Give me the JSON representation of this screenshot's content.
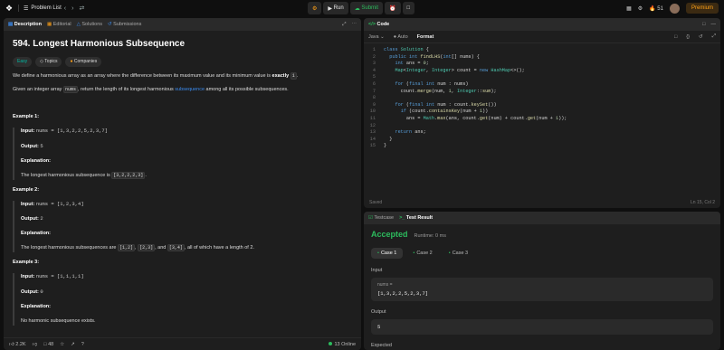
{
  "topbar": {
    "problem_list": "Problem List",
    "run": "Run",
    "submit": "Submit",
    "streak": "51",
    "premium": "Premium"
  },
  "left": {
    "tabs": [
      "Description",
      "Editorial",
      "Solutions",
      "Submissions"
    ],
    "title": "594. Longest Harmonious Subsequence",
    "tags": [
      "Easy",
      "Topics",
      "Companies"
    ],
    "p1_a": "We define a harmonious array as an array where the difference between its maximum value and its minimum value is ",
    "p1_b": "exactly",
    "p1_c": "1",
    "p1_d": ".",
    "p2_a": "Given an integer array ",
    "p2_b": "nums",
    "p2_c": ", return the length of its longest harmonious ",
    "p2_d": "subsequence",
    "p2_e": " among all its possible subsequences.",
    "examples": [
      {
        "head": "Example 1:",
        "input_label": "Input:",
        "input": "nums = [1,3,2,2,5,2,3,7]",
        "output_label": "Output:",
        "output": "5",
        "expl_label": "Explanation:",
        "expl_a": "The longest harmonious subsequence is ",
        "expl_b": "[3,2,2,2,3]",
        "expl_c": "."
      },
      {
        "head": "Example 2:",
        "input_label": "Input:",
        "input": "nums = [1,2,3,4]",
        "output_label": "Output:",
        "output": "2",
        "expl_label": "Explanation:",
        "expl_a": "The longest harmonious subsequences are ",
        "expl_b": "[1,2]",
        "expl_c": ", ",
        "expl_d": "[2,3]",
        "expl_e": ", and ",
        "expl_f": "[3,4]",
        "expl_g": ", all of which have a length of 2."
      },
      {
        "head": "Example 3:",
        "input_label": "Input:",
        "input": "nums = [1,1,1,1]",
        "output_label": "Output:",
        "output": "0",
        "expl_label": "Explanation:",
        "expl_a": "No harmonic subsequence exists."
      }
    ],
    "footer": {
      "likes": "2.2K",
      "comments": "48",
      "online": "13 Online"
    }
  },
  "code": {
    "header": "Code",
    "language": "Java",
    "auto": "Auto",
    "format": "Format",
    "lines": [
      "class Solution {",
      "  public int findLHS(int[] nums) {",
      "    int ans = 0;",
      "    Map<Integer, Integer> count = new HashMap<>();",
      "",
      "    for (final int num : nums)",
      "      count.merge(num, 1, Integer::sum);",
      "",
      "    for (final int num : count.keySet())",
      "      if (count.containsKey(num + 1))",
      "        ans = Math.max(ans, count.get(num) + count.get(num + 1));",
      "",
      "    return ans;",
      "  }",
      "}"
    ],
    "saved": "Saved",
    "position": "Ln 15, Col 2"
  },
  "result": {
    "tabs": [
      "Testcase",
      "Test Result"
    ],
    "status": "Accepted",
    "runtime": "Runtime: 0 ms",
    "cases": [
      "Case 1",
      "Case 2",
      "Case 3"
    ],
    "input_label": "Input",
    "input_var": "nums =",
    "input_value": "[1,3,2,2,5,2,3,7]",
    "output_label": "Output",
    "output_value": "5",
    "expected_label": "Expected"
  }
}
